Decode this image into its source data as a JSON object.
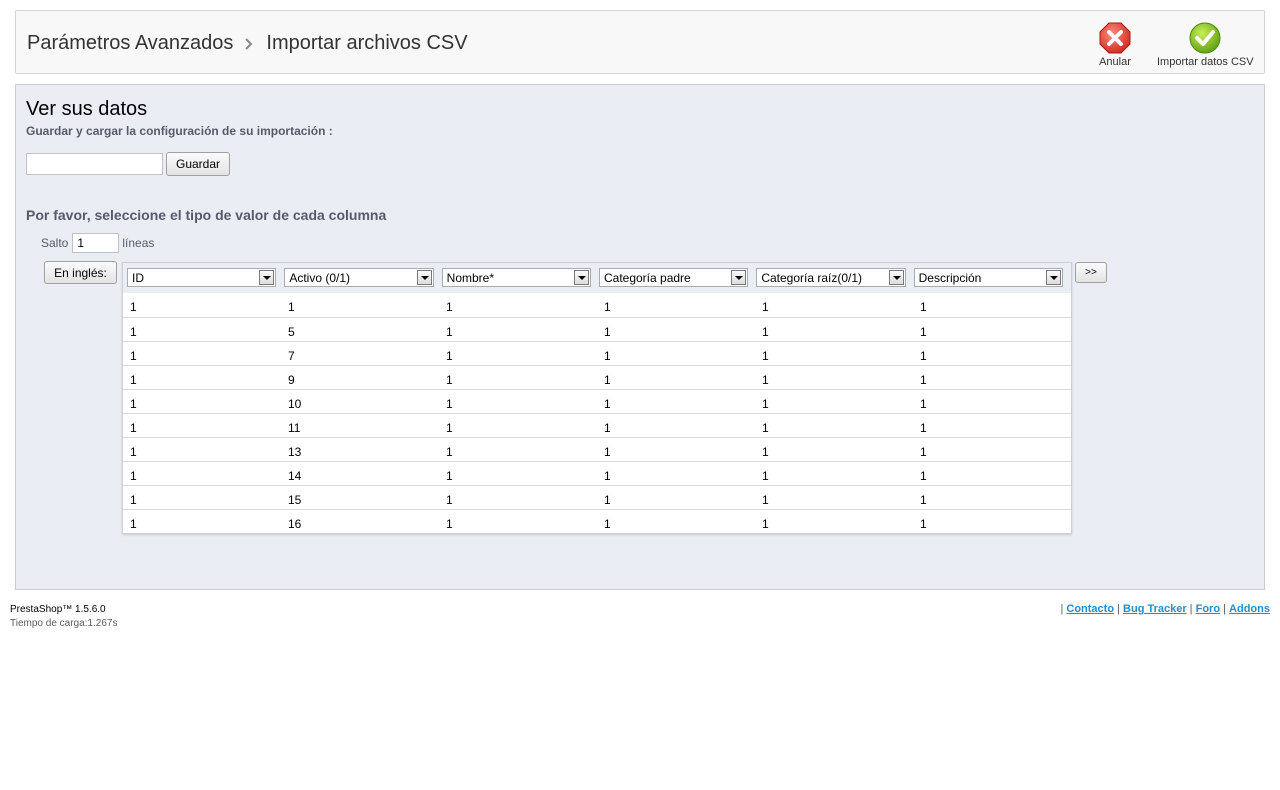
{
  "breadcrumb": {
    "parent": "Parámetros Avanzados",
    "current": "Importar archivos CSV"
  },
  "toolbar": {
    "cancel_label": "Anular",
    "import_label": "Importar datos CSV"
  },
  "main": {
    "title": "Ver sus datos",
    "save_config_label": "Guardar y cargar la configuración de su importación :",
    "save_input_value": "",
    "save_button": "Guardar",
    "column_type_title": "Por favor, seleccione el tipo de valor de cada columna",
    "skip_label": "Salto",
    "skip_value": "1",
    "skip_unit": "líneas",
    "english_button": "En inglés:",
    "next_button": ">>"
  },
  "table": {
    "column_selects": [
      "ID",
      "Activo (0/1)",
      "Nombre*",
      "Categoría padre",
      "Categoría raíz(0/1)",
      "Descripción"
    ],
    "rows": [
      [
        "1",
        "1",
        "1",
        "1",
        "1",
        "1"
      ],
      [
        "1",
        "5",
        "1",
        "1",
        "1",
        "1"
      ],
      [
        "1",
        "7",
        "1",
        "1",
        "1",
        "1"
      ],
      [
        "1",
        "9",
        "1",
        "1",
        "1",
        "1"
      ],
      [
        "1",
        "10",
        "1",
        "1",
        "1",
        "1"
      ],
      [
        "1",
        "11",
        "1",
        "1",
        "1",
        "1"
      ],
      [
        "1",
        "13",
        "1",
        "1",
        "1",
        "1"
      ],
      [
        "1",
        "14",
        "1",
        "1",
        "1",
        "1"
      ],
      [
        "1",
        "15",
        "1",
        "1",
        "1",
        "1"
      ],
      [
        "1",
        "16",
        "1",
        "1",
        "1",
        "1"
      ]
    ]
  },
  "footer": {
    "version": "PrestaShop™ 1.5.6.0",
    "load_time": "Tiempo de carga:1.267s",
    "links": [
      "Contacto",
      "Bug Tracker",
      "Foro",
      "Addons"
    ]
  },
  "colors": {
    "panel_bg": "#ebedf4",
    "link": "#268ccd",
    "cancel_red": "#e03c3c",
    "import_green": "#79b41f"
  }
}
